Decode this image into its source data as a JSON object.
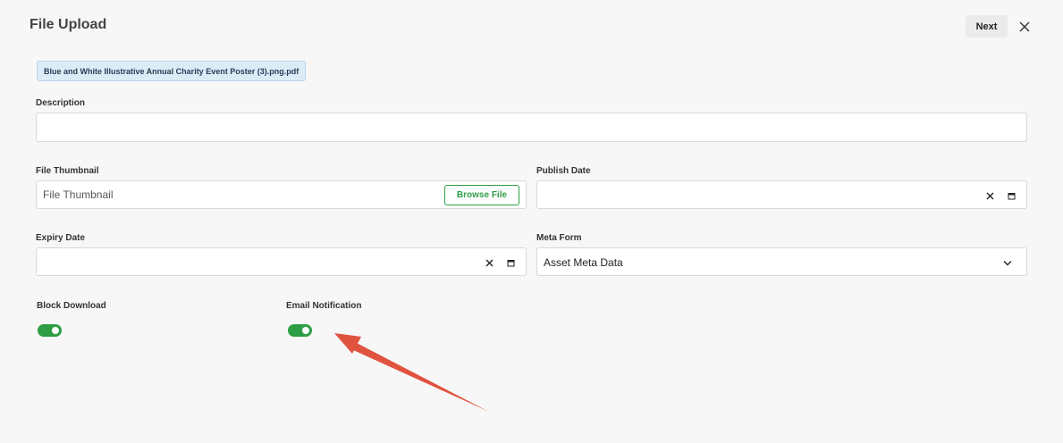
{
  "header": {
    "title": "File Upload",
    "next_label": "Next"
  },
  "file_chip": {
    "filename": "Blue and White Illustrative Annual Charity Event Poster (3).png.pdf"
  },
  "fields": {
    "description": {
      "label": "Description",
      "value": ""
    },
    "file_thumbnail": {
      "label": "File Thumbnail",
      "placeholder": "File Thumbnail",
      "browse_label": "Browse File"
    },
    "publish_date": {
      "label": "Publish Date",
      "value": ""
    },
    "expiry_date": {
      "label": "Expiry Date",
      "value": ""
    },
    "meta_form": {
      "label": "Meta Form",
      "selected": "Asset Meta Data"
    },
    "block_download": {
      "label": "Block Download",
      "enabled": true
    },
    "email_notification": {
      "label": "Email Notification",
      "enabled": true
    }
  },
  "icons": {
    "close": "close-icon",
    "clear": "clear-icon",
    "calendar": "calendar-icon",
    "chevron": "chevron-down-icon"
  },
  "colors": {
    "accent_green": "#2e9e44",
    "chip_background": "#dcecf7",
    "annotation_arrow": "#e0533f"
  }
}
